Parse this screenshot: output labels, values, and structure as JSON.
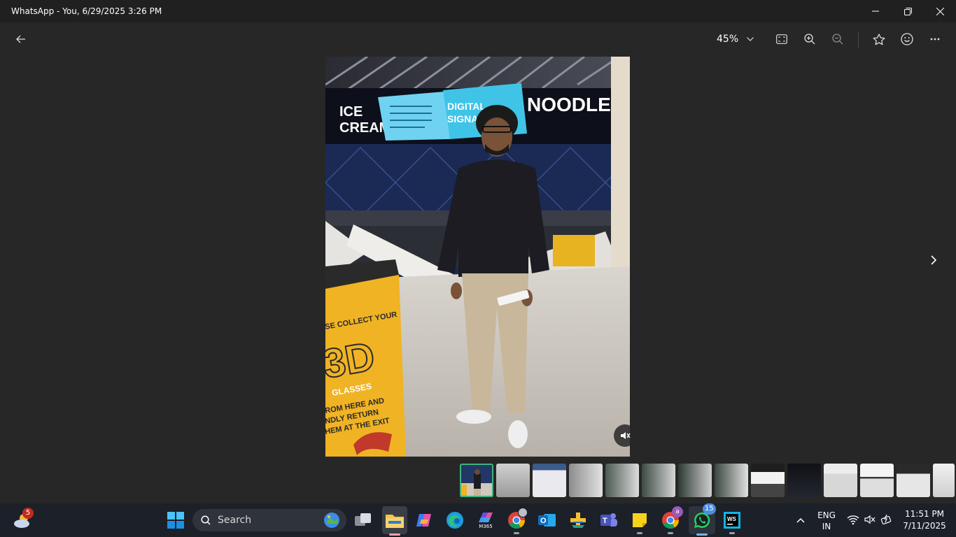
{
  "window": {
    "title": "WhatsApp - You, 6/29/2025 3:26 PM",
    "controls": [
      "minimize",
      "restore",
      "close"
    ]
  },
  "toolbar": {
    "back_icon": "arrow-left-icon",
    "zoom_value": "45%",
    "buttons": [
      "zoom-dropdown",
      "fit-to-screen",
      "zoom-in",
      "zoom-out",
      "star",
      "react-emoji",
      "more-options"
    ]
  },
  "photo": {
    "signs": [
      "ICE CREAM",
      "DIGITAL SIGNAGE",
      "NOODLES"
    ],
    "poster_text": [
      "SE COLLECT YOUR",
      "3D",
      "GLASSES",
      "ROM HERE AND",
      "NDLY RETURN",
      "HEM AT THE EXIT"
    ]
  },
  "filmstrip": {
    "count": 14,
    "selected_index": 0
  },
  "taskbar": {
    "weather_badge": "5",
    "search_placeholder": "Search",
    "apps": [
      "start",
      "search",
      "task-view",
      "file-explorer",
      "copilot",
      "edge",
      "m365",
      "chrome",
      "outlook",
      "app-plus",
      "teams",
      "sticky-notes",
      "chrome-profile",
      "whatsapp",
      "webstorm"
    ],
    "m365_label": "M365",
    "chrome_profile_badge": "a",
    "whatsapp_badge": "15",
    "language": "ENG",
    "region": "IN",
    "time": "11:51 PM",
    "date": "7/11/2025"
  },
  "colors": {
    "app_bg": "#272727",
    "titlebar_bg": "#202020",
    "taskbar_bg": "#1c2028",
    "thumb_active": "#3fb37f",
    "badge_red": "#c42b1c",
    "badge_blue": "#4f8de0"
  }
}
